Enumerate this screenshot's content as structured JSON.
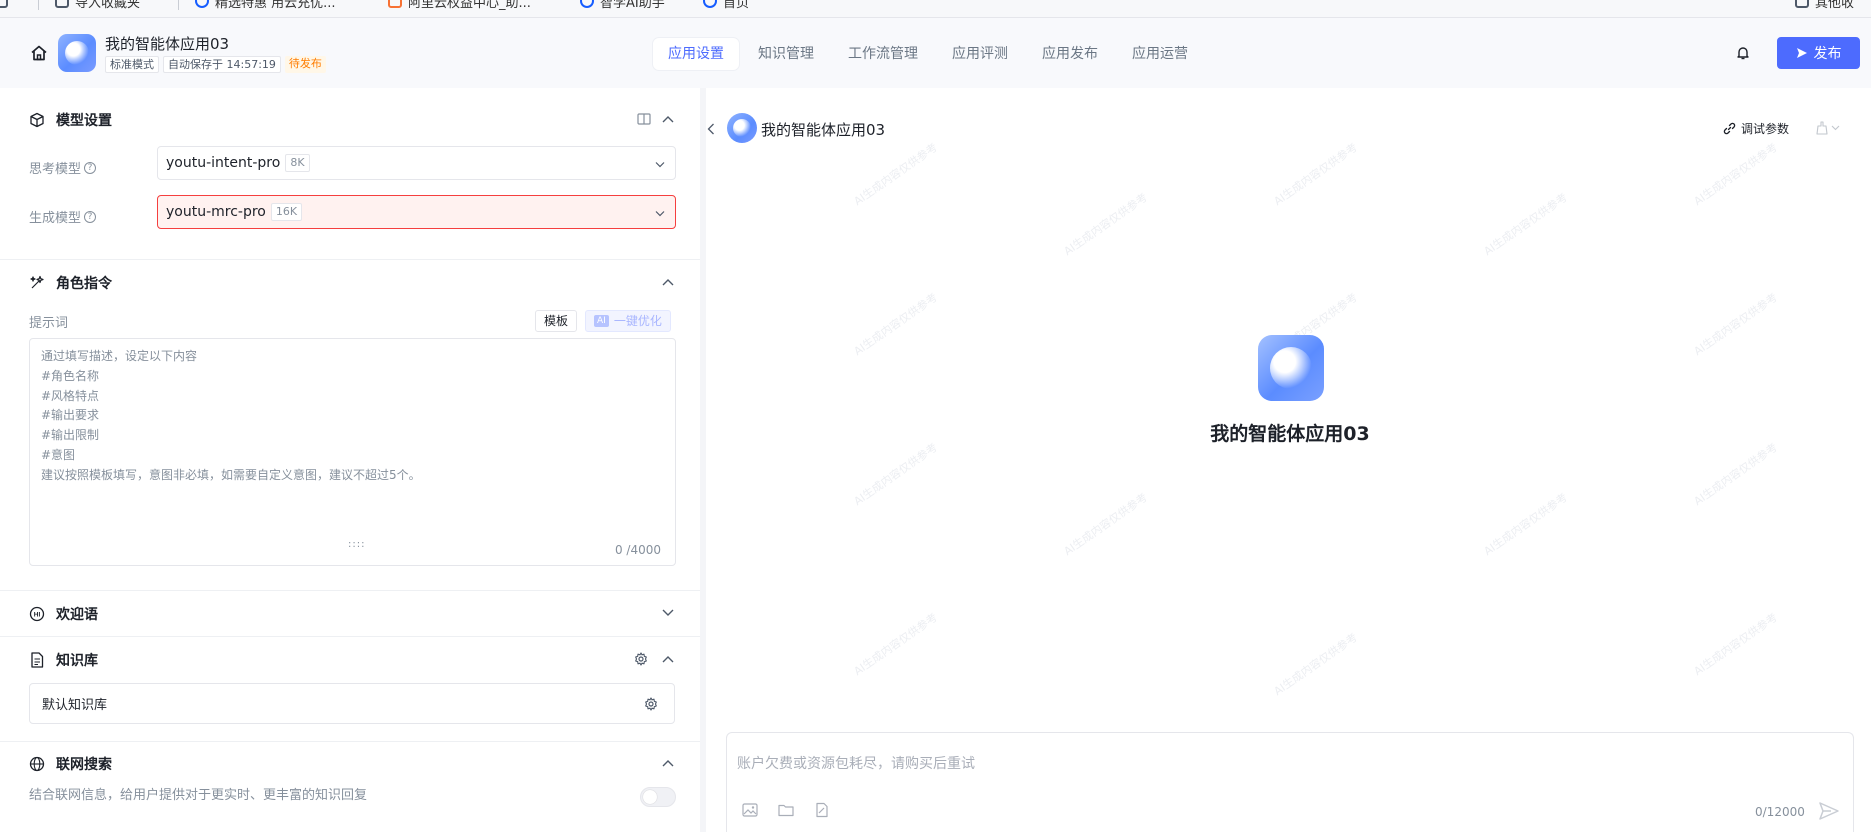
{
  "browser": {
    "bookmarks": [
      {
        "label": "导入收藏夹",
        "icon": "import-icon"
      },
      {
        "label": "精选特惠 用云充优...",
        "icon": "cloud-icon"
      },
      {
        "label": "阿里云权益中心_助...",
        "icon": "aliyun-icon"
      },
      {
        "label": "智学AI助手",
        "icon": "ai-assistant-icon"
      },
      {
        "label": "首页",
        "icon": "home-page-icon"
      }
    ],
    "other_bookmarks": "其他收"
  },
  "header": {
    "app_name": "我的智能体应用03",
    "mode_tag": "标准模式",
    "autosave_tag": "自动保存于 14:57:19",
    "status_tag": "待发布",
    "nav_tabs": [
      "应用设置",
      "知识管理",
      "工作流管理",
      "应用评测",
      "应用发布",
      "应用运营"
    ],
    "active_tab": "应用设置",
    "publish_label": "发布"
  },
  "left_panel": {
    "model_settings": {
      "title": "模型设置",
      "think_model_label": "思考模型",
      "think_model_value": "youtu-intent-pro",
      "think_model_ctx": "8K",
      "gen_model_label": "生成模型",
      "gen_model_value": "youtu-mrc-pro",
      "gen_model_ctx": "16K"
    },
    "role_instruction": {
      "title": "角色指令",
      "prompt_label": "提示词",
      "template_btn": "模板",
      "ai_badge": "AI",
      "optimize_btn": "一键优化",
      "placeholder": "通过填写描述，设定以下内容\n#角色名称\n#风格特点\n#输出要求\n#输出限制\n#意图\n建议按照模板填写，意图非必填，如需要自定义意图，建议不超过5个。",
      "counter": "0 /4000"
    },
    "welcome": {
      "title": "欢迎语"
    },
    "knowledge": {
      "title": "知识库",
      "default_kb": "默认知识库"
    },
    "web_search": {
      "title": "联网搜索",
      "description": "结合联网信息，给用户提供对于更实时、更丰富的知识回复",
      "enabled": false
    }
  },
  "right_panel": {
    "chat_title": "我的智能体应用03",
    "debug_label": "调试参数",
    "center_title": "我的智能体应用03",
    "input_placeholder": "账户欠费或资源包耗尽，请购买后重试",
    "input_counter": "0/12000",
    "watermark_text": "AI生成内容仅供参考"
  },
  "colors": {
    "accent": "#4d6bfe",
    "pending": "#ff7d00",
    "error_border": "#f53f3f"
  }
}
